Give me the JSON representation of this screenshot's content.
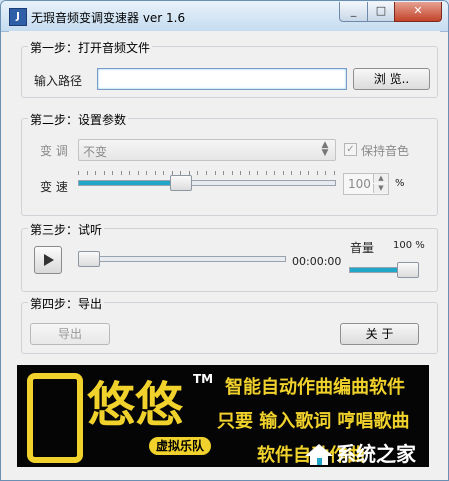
{
  "window": {
    "title": "无瑕音频变调变速器 ver 1.6",
    "icon_name": "app-icon",
    "min_icon": "minimize-icon",
    "max_icon": "maximize-icon",
    "close_icon": "close-icon"
  },
  "step1": {
    "legend": "第一步：打开音频文件",
    "input_label": "输入路径",
    "path_value": "",
    "browse_label": "浏 览.."
  },
  "step2": {
    "legend": "第二步：设置参数",
    "pitch_label": "变 调",
    "pitch_value": "不变",
    "keep_pitch_label": "保持音色",
    "keep_pitch_checked": true,
    "speed_label": "变 速",
    "speed_value": "100",
    "speed_unit": "%",
    "speed_level": 0.4
  },
  "step3": {
    "legend": "第三步：试听",
    "play_icon": "play-icon",
    "time": "00:00:00",
    "volume_label": "音量",
    "volume_value": "100 %",
    "progress_level": 0,
    "volume_level": 1.0
  },
  "step4": {
    "legend": "第四步：导出",
    "export_label": "导出",
    "about_label": "关 于"
  },
  "banner": {
    "logo_text": "悠悠",
    "logo_tag": "虚拟乐队",
    "tm": "TM",
    "line1": "智能自动作曲编曲软件",
    "line2": "只要 输入歌词  哼唱歌曲",
    "line3": "软件自动作曲",
    "watermark": "系统之家"
  },
  "colors": {
    "accent_fill": "#1fa6c9",
    "banner_yellow": "#f1d22c"
  }
}
